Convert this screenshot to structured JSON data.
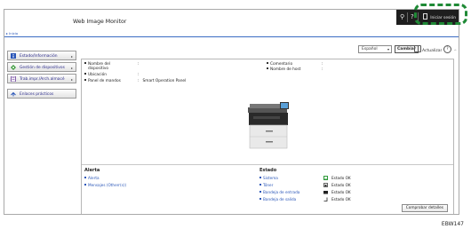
{
  "header": {
    "title": "Web Image Monitor",
    "search_icon": "search-icon",
    "help_glyph": "?",
    "login_label": "Iniciar sesión",
    "breadcrumb": "▸ Inicio"
  },
  "toolbar": {
    "language": "Español",
    "change_label": "Cambiar",
    "refresh_label": "Actualizar",
    "help_glyph": "?"
  },
  "sidebar": {
    "items": [
      {
        "label": "Estado/Información",
        "icon": "info-icon"
      },
      {
        "label": "Gestión de dispositivos",
        "icon": "device-management-icon"
      },
      {
        "label": "Trab.impr./Arch.almacé",
        "icon": "print-jobs-icon"
      },
      {
        "label": "Enlaces prácticos",
        "icon": "links-icon"
      }
    ]
  },
  "device": {
    "name_label": "Nombre del dispositivo",
    "name_value": ":",
    "location_label": "Ubicación",
    "location_value": ":",
    "panel_label": "Panel de mandos",
    "panel_value": ":   Smart Operation Panel",
    "comment_label": "Comentario",
    "comment_value": ":",
    "host_label": "Nombre de host",
    "host_value": ":"
  },
  "alert": {
    "title": "Alerta",
    "items": [
      "Alerta",
      "Mensajes (Otherr(s))"
    ]
  },
  "status": {
    "title": "Estado",
    "rows": [
      {
        "label": "Sistema",
        "icon": "system-ok-icon",
        "value": "Estado OK"
      },
      {
        "label": "Tóner",
        "icon": "toner-icon",
        "value": "Estado OK"
      },
      {
        "label": "Bandeja de entrada",
        "icon": "input-tray-icon",
        "value": "Estado OK"
      },
      {
        "label": "Bandeja de salida",
        "icon": "output-tray-icon",
        "value": "Estado OK"
      }
    ]
  },
  "details_button": "Comprobar detalles",
  "corner_code": "EBW147",
  "colors": {
    "accent_blue": "#2a56b8",
    "header_dark": "#1e1e1e",
    "callout_green": "#1f8a36"
  }
}
